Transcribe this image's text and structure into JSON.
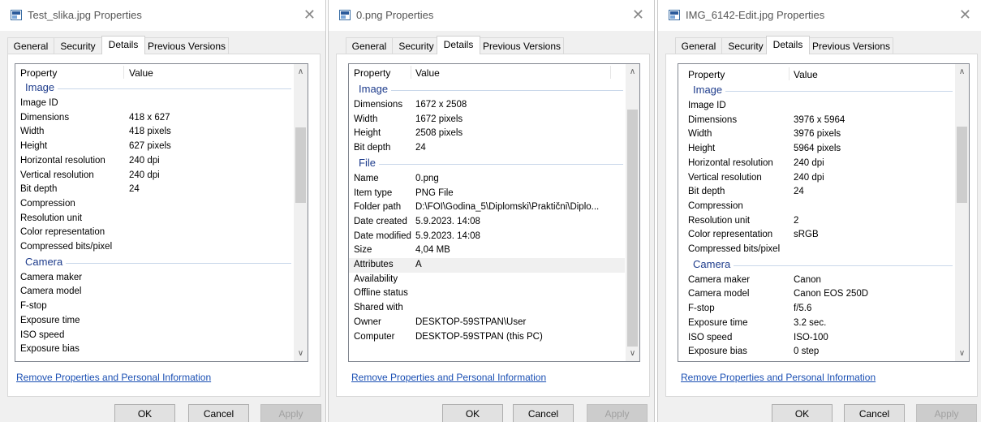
{
  "tabs": [
    "General",
    "Security",
    "Details",
    "Previous Versions"
  ],
  "header": {
    "property": "Property",
    "value": "Value"
  },
  "link": "Remove Properties and Personal Information",
  "buttons": {
    "ok": "OK",
    "cancel": "Cancel",
    "apply": "Apply"
  },
  "dialogs": [
    {
      "title": "Test_slika.jpg Properties",
      "sections": [
        {
          "label": "Image"
        },
        {
          "rows": [
            {
              "k": "Image ID",
              "v": ""
            },
            {
              "k": "Dimensions",
              "v": "418 x 627"
            },
            {
              "k": "Width",
              "v": "418 pixels"
            },
            {
              "k": "Height",
              "v": "627 pixels"
            },
            {
              "k": "Horizontal resolution",
              "v": "240 dpi"
            },
            {
              "k": "Vertical resolution",
              "v": "240 dpi"
            },
            {
              "k": "Bit depth",
              "v": "24"
            },
            {
              "k": "Compression",
              "v": ""
            },
            {
              "k": "Resolution unit",
              "v": ""
            },
            {
              "k": "Color representation",
              "v": ""
            },
            {
              "k": "Compressed bits/pixel",
              "v": ""
            }
          ]
        },
        {
          "label": "Camera"
        },
        {
          "rows": [
            {
              "k": "Camera maker",
              "v": ""
            },
            {
              "k": "Camera model",
              "v": ""
            },
            {
              "k": "F-stop",
              "v": ""
            },
            {
              "k": "Exposure time",
              "v": ""
            },
            {
              "k": "ISO speed",
              "v": ""
            },
            {
              "k": "Exposure bias",
              "v": ""
            }
          ]
        }
      ]
    },
    {
      "title": "0.png Properties",
      "sections": [
        {
          "label": "Image"
        },
        {
          "rows": [
            {
              "k": "Dimensions",
              "v": "1672 x 2508"
            },
            {
              "k": "Width",
              "v": "1672 pixels"
            },
            {
              "k": "Height",
              "v": "2508 pixels"
            },
            {
              "k": "Bit depth",
              "v": "24"
            }
          ]
        },
        {
          "label": "File"
        },
        {
          "rows": [
            {
              "k": "Name",
              "v": "0.png"
            },
            {
              "k": "Item type",
              "v": "PNG File"
            },
            {
              "k": "Folder path",
              "v": "D:\\FOI\\Godina_5\\Diplomski\\Praktični\\Diplo..."
            },
            {
              "k": "Date created",
              "v": "5.9.2023. 14:08"
            },
            {
              "k": "Date modified",
              "v": "5.9.2023. 14:08"
            },
            {
              "k": "Size",
              "v": "4,04 MB"
            },
            {
              "k": "Attributes",
              "v": "A",
              "hl": true
            },
            {
              "k": "Availability",
              "v": ""
            },
            {
              "k": "Offline status",
              "v": ""
            },
            {
              "k": "Shared with",
              "v": ""
            },
            {
              "k": "Owner",
              "v": "DESKTOP-59STPAN\\User"
            },
            {
              "k": "Computer",
              "v": "DESKTOP-59STPAN (this PC)"
            }
          ]
        }
      ]
    },
    {
      "title": "IMG_6142-Edit.jpg Properties",
      "sections": [
        {
          "label": "Image"
        },
        {
          "rows": [
            {
              "k": "Image ID",
              "v": ""
            },
            {
              "k": "Dimensions",
              "v": "3976 x 5964"
            },
            {
              "k": "Width",
              "v": "3976 pixels"
            },
            {
              "k": "Height",
              "v": "5964 pixels"
            },
            {
              "k": "Horizontal resolution",
              "v": "240 dpi"
            },
            {
              "k": "Vertical resolution",
              "v": "240 dpi"
            },
            {
              "k": "Bit depth",
              "v": "24"
            },
            {
              "k": "Compression",
              "v": ""
            },
            {
              "k": "Resolution unit",
              "v": "2"
            },
            {
              "k": "Color representation",
              "v": "sRGB"
            },
            {
              "k": "Compressed bits/pixel",
              "v": ""
            }
          ]
        },
        {
          "label": "Camera"
        },
        {
          "rows": [
            {
              "k": "Camera maker",
              "v": "Canon"
            },
            {
              "k": "Camera model",
              "v": "Canon EOS 250D"
            },
            {
              "k": "F-stop",
              "v": "f/5.6"
            },
            {
              "k": "Exposure time",
              "v": "3.2 sec."
            },
            {
              "k": "ISO speed",
              "v": "ISO-100"
            },
            {
              "k": "Exposure bias",
              "v": "0 step"
            }
          ]
        }
      ]
    }
  ]
}
